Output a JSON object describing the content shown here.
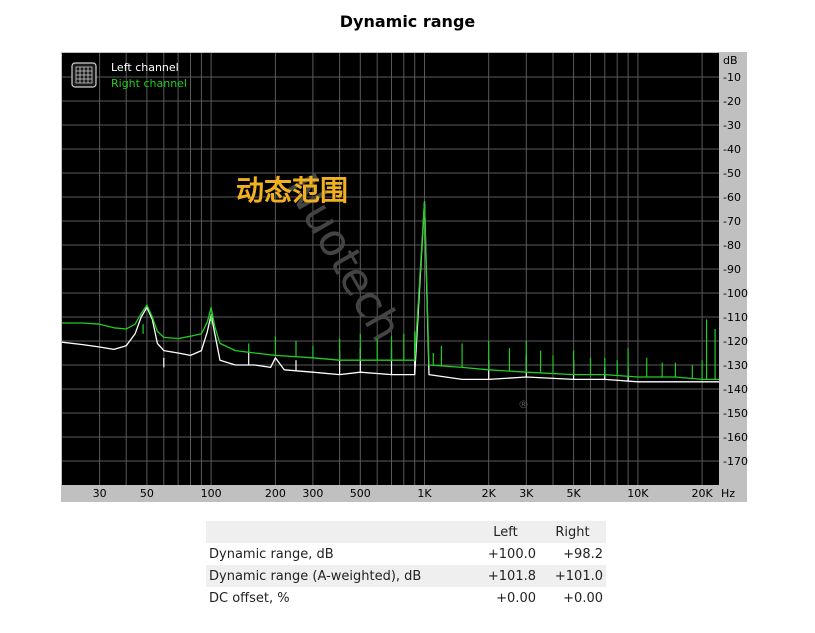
{
  "page": {
    "title": "Dynamic range",
    "watermark_cn": "动态范围",
    "watermark_brand": "Nuotech",
    "registered_mark": "®"
  },
  "colors": {
    "plot_background": "#000000",
    "grid": "#5a5a5a",
    "frame": "#c0c0c0",
    "left_channel": "#ffffff",
    "right_channel": "#22cc22",
    "watermark_cn": "#f0b020",
    "watermark_brand": "#444444"
  },
  "chart_data": {
    "type": "line",
    "title": "Dynamic range",
    "xscale": "log",
    "yunit": "dB",
    "xunit": "Hz",
    "xlim": [
      20,
      24000
    ],
    "ylim": [
      -180,
      0
    ],
    "grid": true,
    "legend_position": "top-left",
    "legend_icon": "grid-icon",
    "x_ticks": [
      {
        "value": 30,
        "label": "30"
      },
      {
        "value": 50,
        "label": "50"
      },
      {
        "value": 100,
        "label": "100"
      },
      {
        "value": 200,
        "label": "200"
      },
      {
        "value": 300,
        "label": "300"
      },
      {
        "value": 500,
        "label": "500"
      },
      {
        "value": 1000,
        "label": "1K"
      },
      {
        "value": 2000,
        "label": "2K"
      },
      {
        "value": 3000,
        "label": "3K"
      },
      {
        "value": 5000,
        "label": "5K"
      },
      {
        "value": 10000,
        "label": "10K"
      },
      {
        "value": 20000,
        "label": "20K"
      }
    ],
    "y_ticks": [
      {
        "value": -10,
        "label": "-10"
      },
      {
        "value": -20,
        "label": "-20"
      },
      {
        "value": -30,
        "label": "-30"
      },
      {
        "value": -40,
        "label": "-40"
      },
      {
        "value": -50,
        "label": "-50"
      },
      {
        "value": -60,
        "label": "-60"
      },
      {
        "value": -70,
        "label": "-70"
      },
      {
        "value": -80,
        "label": "-80"
      },
      {
        "value": -90,
        "label": "-90"
      },
      {
        "value": -100,
        "label": "-100"
      },
      {
        "value": -110,
        "label": "-110"
      },
      {
        "value": -120,
        "label": "-120"
      },
      {
        "value": -130,
        "label": "-130"
      },
      {
        "value": -140,
        "label": "-140"
      },
      {
        "value": -150,
        "label": "-150"
      },
      {
        "value": -160,
        "label": "-160"
      },
      {
        "value": -170,
        "label": "-170"
      }
    ],
    "series": [
      {
        "name": "Left channel",
        "color": "#ffffff",
        "points": [
          [
            20,
            -120.5
          ],
          [
            25,
            -121.5
          ],
          [
            30,
            -122.5
          ],
          [
            35,
            -123.5
          ],
          [
            40,
            -122
          ],
          [
            44,
            -117
          ],
          [
            47,
            -110
          ],
          [
            50,
            -106
          ],
          [
            53,
            -111
          ],
          [
            56,
            -121
          ],
          [
            60,
            -124
          ],
          [
            70,
            -125
          ],
          [
            80,
            -126
          ],
          [
            90,
            -124
          ],
          [
            96,
            -116
          ],
          [
            100,
            -109
          ],
          [
            104,
            -117
          ],
          [
            110,
            -128
          ],
          [
            130,
            -130
          ],
          [
            160,
            -130
          ],
          [
            190,
            -131
          ],
          [
            200,
            -127
          ],
          [
            220,
            -132
          ],
          [
            300,
            -133
          ],
          [
            400,
            -134
          ],
          [
            500,
            -133
          ],
          [
            700,
            -134
          ],
          [
            900,
            -134
          ],
          [
            1000,
            -62
          ],
          [
            1050,
            -134
          ],
          [
            1500,
            -136
          ],
          [
            2000,
            -136
          ],
          [
            3000,
            -135
          ],
          [
            5000,
            -136
          ],
          [
            7000,
            -136
          ],
          [
            10000,
            -137
          ],
          [
            15000,
            -137
          ],
          [
            20000,
            -137
          ],
          [
            24000,
            -137
          ]
        ],
        "spikes": [
          [
            60,
            -127
          ],
          [
            150,
            -124
          ],
          [
            250,
            -128
          ],
          [
            400,
            -124
          ],
          [
            500,
            -123
          ],
          [
            700,
            -123
          ],
          [
            900,
            -121
          ],
          [
            2000,
            -128
          ],
          [
            3000,
            -126
          ],
          [
            5000,
            -128
          ],
          [
            7000,
            -131
          ],
          [
            9000,
            -131
          ]
        ]
      },
      {
        "name": "Right channel",
        "color": "#22cc22",
        "points": [
          [
            20,
            -112.5
          ],
          [
            25,
            -112.5
          ],
          [
            30,
            -113
          ],
          [
            35,
            -114.5
          ],
          [
            40,
            -115
          ],
          [
            44,
            -113
          ],
          [
            47,
            -108.5
          ],
          [
            50,
            -105
          ],
          [
            53,
            -110
          ],
          [
            56,
            -116
          ],
          [
            60,
            -118.5
          ],
          [
            70,
            -119
          ],
          [
            80,
            -118
          ],
          [
            90,
            -117
          ],
          [
            96,
            -112
          ],
          [
            100,
            -106
          ],
          [
            104,
            -114
          ],
          [
            110,
            -121
          ],
          [
            130,
            -124
          ],
          [
            160,
            -125
          ],
          [
            200,
            -126
          ],
          [
            300,
            -127
          ],
          [
            400,
            -128
          ],
          [
            500,
            -128
          ],
          [
            700,
            -128
          ],
          [
            900,
            -128
          ],
          [
            1000,
            -62
          ],
          [
            1050,
            -130
          ],
          [
            1500,
            -131
          ],
          [
            2000,
            -132
          ],
          [
            3000,
            -133
          ],
          [
            5000,
            -134
          ],
          [
            7000,
            -134
          ],
          [
            10000,
            -135
          ],
          [
            15000,
            -135
          ],
          [
            20000,
            -136
          ],
          [
            24000,
            -136
          ]
        ],
        "spikes": [
          [
            48,
            -113
          ],
          [
            100,
            -109
          ],
          [
            150,
            -121
          ],
          [
            200,
            -118
          ],
          [
            250,
            -120
          ],
          [
            300,
            -122
          ],
          [
            400,
            -119
          ],
          [
            500,
            -117
          ],
          [
            600,
            -119
          ],
          [
            700,
            -118
          ],
          [
            800,
            -117
          ],
          [
            900,
            -116
          ],
          [
            1100,
            -125
          ],
          [
            1200,
            -122
          ],
          [
            1500,
            -121
          ],
          [
            2000,
            -120
          ],
          [
            2500,
            -123
          ],
          [
            3000,
            -120
          ],
          [
            3500,
            -124
          ],
          [
            4000,
            -126
          ],
          [
            5000,
            -124
          ],
          [
            6000,
            -127
          ],
          [
            7000,
            -127
          ],
          [
            8000,
            -128
          ],
          [
            9000,
            -123
          ],
          [
            11000,
            -127
          ],
          [
            13000,
            -129
          ],
          [
            15000,
            -129
          ],
          [
            18000,
            -130
          ],
          [
            20000,
            -128
          ],
          [
            21000,
            -111
          ],
          [
            23000,
            -115
          ]
        ]
      }
    ]
  },
  "results": {
    "columns": [
      "",
      "Left",
      "Right"
    ],
    "rows": [
      {
        "label": "Dynamic range, dB",
        "left": "+100.0",
        "right": "+98.2"
      },
      {
        "label": "Dynamic range (A-weighted), dB",
        "left": "+101.8",
        "right": "+101.0"
      },
      {
        "label": "DC offset, %",
        "left": "+0.00",
        "right": "+0.00"
      }
    ]
  }
}
